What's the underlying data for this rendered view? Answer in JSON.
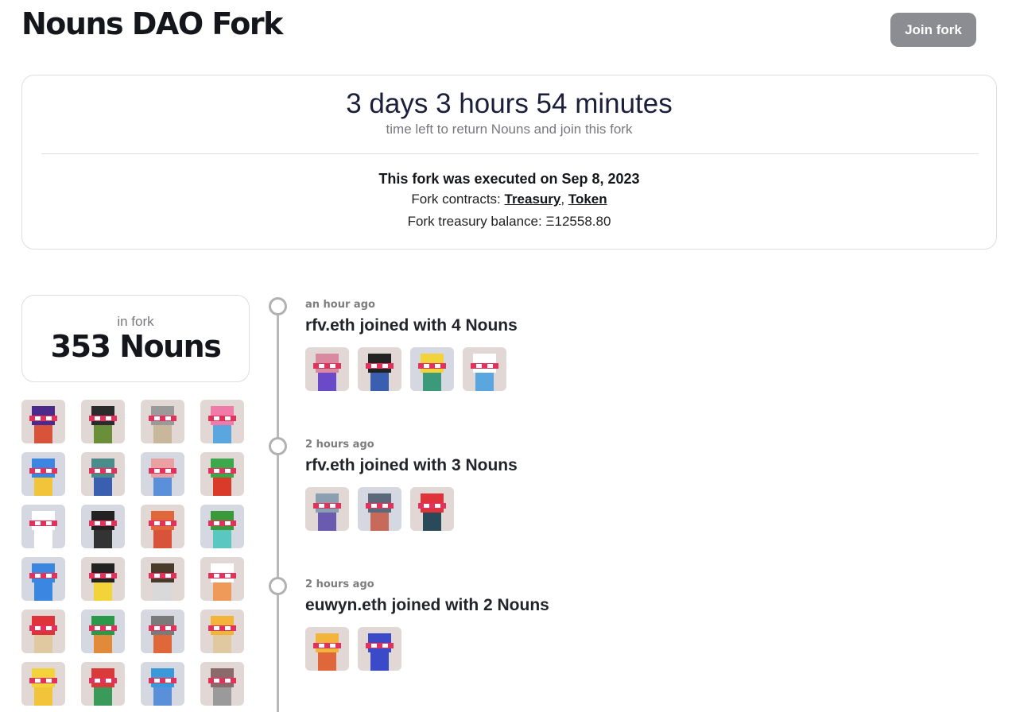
{
  "header": {
    "title": "Nouns DAO Fork",
    "join_button": "Join fork"
  },
  "fork_info": {
    "countdown": "3 days 3 hours 54 minutes",
    "countdown_caption": "time left to return Nouns and join this fork",
    "executed_text": "This fork was executed on Sep 8, 2023",
    "contracts_label": "Fork contracts:",
    "contract_links": [
      "Treasury",
      "Token"
    ],
    "treasury_label": "Fork treasury balance:",
    "treasury_value": "Ξ12558.80"
  },
  "fork_count": {
    "label": "in fork",
    "value": "353 Nouns"
  },
  "colors": {
    "noun_bg_warm": "#e1d7d5",
    "noun_bg_cool": "#d5d7e1",
    "glasses_red": "#e0325a",
    "button_gray": "#8c8d92"
  },
  "grid_nouns": [
    {
      "bg": "#e1d7d5",
      "head": "#4b2a8c",
      "body": "#d9533a"
    },
    {
      "bg": "#e1d7d5",
      "head": "#2b2b2b",
      "body": "#6b8e3a"
    },
    {
      "bg": "#e1d7d5",
      "head": "#9a9a9a",
      "body": "#c9b79c"
    },
    {
      "bg": "#e1d7d5",
      "head": "#f07aa8",
      "body": "#5aa7e0"
    },
    {
      "bg": "#d5d7e1",
      "head": "#3a86e0",
      "body": "#f2c43a"
    },
    {
      "bg": "#e1d7d5",
      "head": "#4a8c8c",
      "body": "#3a5fb0"
    },
    {
      "bg": "#d5d7e1",
      "head": "#e8a0a0",
      "body": "#5a8fd9"
    },
    {
      "bg": "#e1d7d5",
      "head": "#3aa84b",
      "body": "#d93a2a"
    },
    {
      "bg": "#d5d7e1",
      "head": "#ffffff",
      "body": "#ffffff"
    },
    {
      "bg": "#d5d7e1",
      "head": "#222222",
      "body": "#333333"
    },
    {
      "bg": "#e1d7d5",
      "head": "#e0673a",
      "body": "#d9533a"
    },
    {
      "bg": "#d5d7e1",
      "head": "#3a9a3a",
      "body": "#5ac8c0"
    },
    {
      "bg": "#d5d7e1",
      "head": "#3a86e0",
      "body": "#3a86e0"
    },
    {
      "bg": "#e1d7d5",
      "head": "#222222",
      "body": "#f2d43a"
    },
    {
      "bg": "#e1d7d5",
      "head": "#4a3a2a",
      "body": "#d9d9d9"
    },
    {
      "bg": "#e1d7d5",
      "head": "#ffffff",
      "body": "#f09a5a"
    },
    {
      "bg": "#e1d7d5",
      "head": "#e0323a",
      "body": "#e0c9a0"
    },
    {
      "bg": "#d5d7e1",
      "head": "#2a9a4a",
      "body": "#e08a3a"
    },
    {
      "bg": "#d5d7e1",
      "head": "#7a7a7a",
      "body": "#e0673a"
    },
    {
      "bg": "#e1d7d5",
      "head": "#f2b43a",
      "body": "#e0c9a0"
    },
    {
      "bg": "#e1d7d5",
      "head": "#f2d43a",
      "body": "#f2c43a"
    },
    {
      "bg": "#e1d7d5",
      "head": "#d93a3a",
      "body": "#3a9a5a"
    },
    {
      "bg": "#d5d7e1",
      "head": "#3a9ad9",
      "body": "#5a8fd9"
    },
    {
      "bg": "#e1d7d5",
      "head": "#8a6a6a",
      "body": "#9a9a9a"
    }
  ],
  "events": [
    {
      "time": "an hour ago",
      "title": "rfv.eth joined with 4 Nouns",
      "nouns": [
        {
          "bg": "#e1d7d5",
          "head": "#d98aa0",
          "body": "#6a4ac8"
        },
        {
          "bg": "#e1d7d5",
          "head": "#222222",
          "body": "#3a5fb0"
        },
        {
          "bg": "#d5d7e1",
          "head": "#f2d43a",
          "body": "#3a9a7a"
        },
        {
          "bg": "#e1d7d5",
          "head": "#ffffff",
          "body": "#5aa7e0"
        }
      ]
    },
    {
      "time": "2 hours ago",
      "title": "rfv.eth joined with 3 Nouns",
      "nouns": [
        {
          "bg": "#e1d7d5",
          "head": "#8aa0b0",
          "body": "#6a5ab0"
        },
        {
          "bg": "#d5d7e1",
          "head": "#5a6a7a",
          "body": "#c86a5a"
        },
        {
          "bg": "#e1d7d5",
          "head": "#e0323a",
          "body": "#2a4a5a"
        }
      ]
    },
    {
      "time": "2 hours ago",
      "title": "euwyn.eth joined with 2 Nouns",
      "nouns": [
        {
          "bg": "#e1d7d5",
          "head": "#f2b43a",
          "body": "#e0673a"
        },
        {
          "bg": "#e1d7d5",
          "head": "#3a4ac8",
          "body": "#3a4ac8"
        }
      ]
    }
  ]
}
